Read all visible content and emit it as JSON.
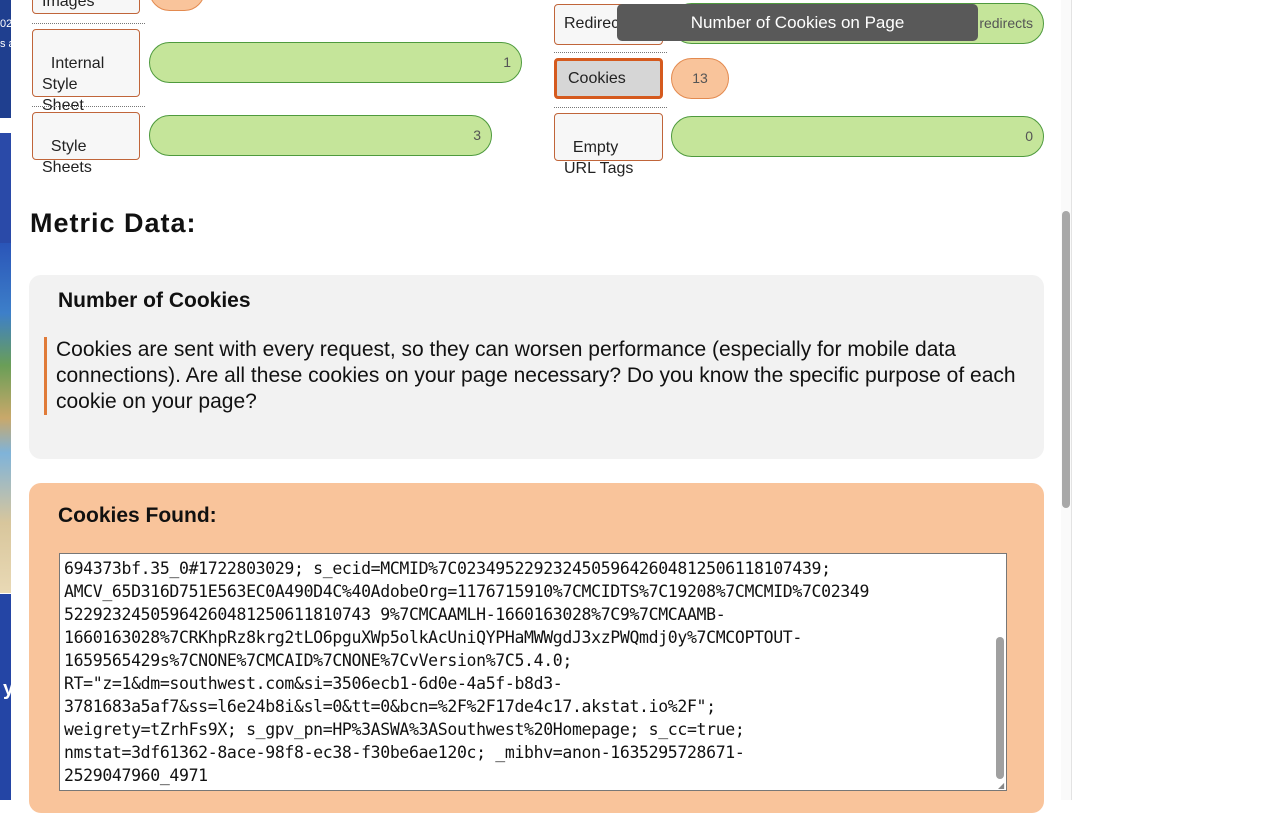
{
  "background": {
    "top_text": "02\ns a",
    "bottom_letter": "y"
  },
  "left_rows": [
    {
      "label": "Images",
      "value": ""
    },
    {
      "label": "Internal\nStyle\nSheet",
      "value": "1"
    },
    {
      "label": "Style\nSheets",
      "value": "3"
    }
  ],
  "right_rows": [
    {
      "label": "Redirects",
      "value": "redirects"
    },
    {
      "label": "Cookies",
      "value": "13"
    },
    {
      "label": "Empty\nURL Tags",
      "value": "0"
    }
  ],
  "tooltip": "Number of Cookies on Page",
  "metric_title": "Metric Data:",
  "metric": {
    "title": "Number of Cookies",
    "description": "Cookies are sent with every request, so they can worsen performance (especially for mobile data connections). Are all these cookies on your page necessary? Do you know the specific purpose of each cookie on your page?"
  },
  "cookies": {
    "title": "Cookies Found:",
    "text": "694373bf.35_0#1722803029; s_ecid=MCMID%7C02349522923245059642604812506118107439;\nAMCV_65D316D751E563EC0A490D4C%40AdobeOrg=1176715910%7CMCIDTS%7C19208%7CMCMID%7C02349\n52292324505964260481250611810743 9%7CMCAAMLH-1660163028%7C9%7CMCAAMB-\n1660163028%7CRKhpRz8krg2tLO6pguXWp5olkAcUniQYPHaMWWgdJ3xzPWQmdj0y%7CMCOPTOUT-\n1659565429s%7CNONE%7CMCAID%7CNONE%7CvVersion%7C5.4.0;\nRT=\"z=1&dm=southwest.com&si=3506ecb1-6d0e-4a5f-b8d3-\n3781683a5af7&ss=l6e24b8i&sl=0&tt=0&bcn=%2F%2F17de4c17.akstat.io%2F\";\nweigrety=tZrhFs9X; s_gpv_pn=HP%3ASWA%3ASouthwest%20Homepage; s_cc=true;\nnmstat=3df61362-8ace-98f8-ec38-f30be6ae120c; _mibhv=anon-1635295728671-\n2529047960_4971"
  },
  "colors": {
    "green_bar": "#c5e59a",
    "orange_bar": "#f9c49b",
    "accent": "#e07b39"
  }
}
